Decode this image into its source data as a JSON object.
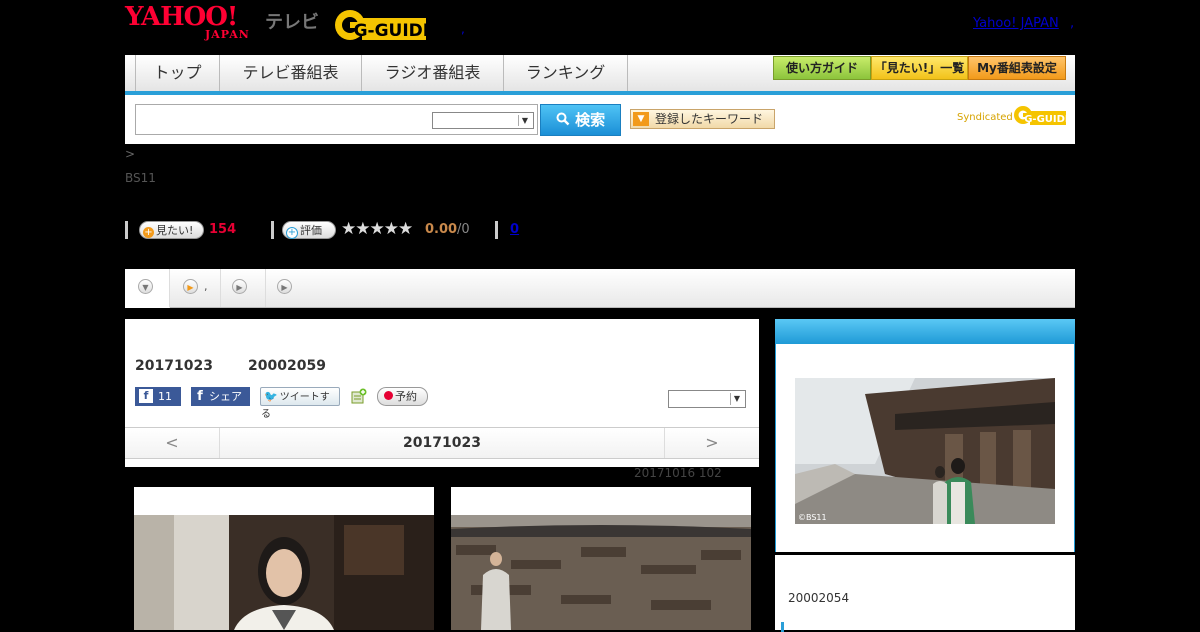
{
  "header": {
    "yahoo_top": "YAHOO!",
    "yahoo_bottom": "JAPAN",
    "tv_label": "テレビ",
    "gguide_logo": "G-GUIDE",
    "yahoo_japan_link": "Yahoo! JAPAN",
    "link_separator": ",",
    "dot_separator": ","
  },
  "nav": {
    "tabs": [
      "トップ",
      "テレビ番組表",
      "ラジオ番組表",
      "ランキング"
    ],
    "guide_button": "使い方ガイド",
    "mitai_list_button": "「見たい!」一覧",
    "my_settings_button": "My番組表設定"
  },
  "search": {
    "input_value": "",
    "select_value": "",
    "button_label": "検索",
    "keyword_button": "登録したキーワード",
    "syndicated_label": "Syndicated",
    "syndicated_logo": "G-GUIDE"
  },
  "breadcrumb": {
    "text": ">"
  },
  "channel": {
    "name": "BS11"
  },
  "ratings": {
    "mitai_button": "見たい!",
    "mitai_count": "154",
    "hyoka_button": "評価",
    "stars": "★★★★★",
    "score": "0.00",
    "score_denom": "/0",
    "reviews_link": "0"
  },
  "subtabs": {
    "item2_label": ","
  },
  "program": {
    "date": "20171023",
    "id": "20002059",
    "fb_count": "11",
    "fb_share": "シェア",
    "tweet_label": "ツイートする",
    "reserve_label": "予約",
    "select_value": "",
    "date_nav": {
      "prev": "<",
      "current": "20171023",
      "next": ">"
    },
    "meta": "20171016  102"
  },
  "side": {
    "program_id": "20002054",
    "image_credit": "©BS11"
  },
  "colors": {
    "page_bg": "#000000",
    "accent_blue": "#2a9fd8",
    "yahoo_red": "#ff0033",
    "count_red": "#e60033"
  },
  "icons": [
    "search-icon",
    "dropdown-arrow-icon",
    "plus-icon",
    "star-icon",
    "play-circle-icon",
    "facebook-icon",
    "twitter-bird-icon",
    "add-list-icon",
    "record-dot-icon"
  ]
}
